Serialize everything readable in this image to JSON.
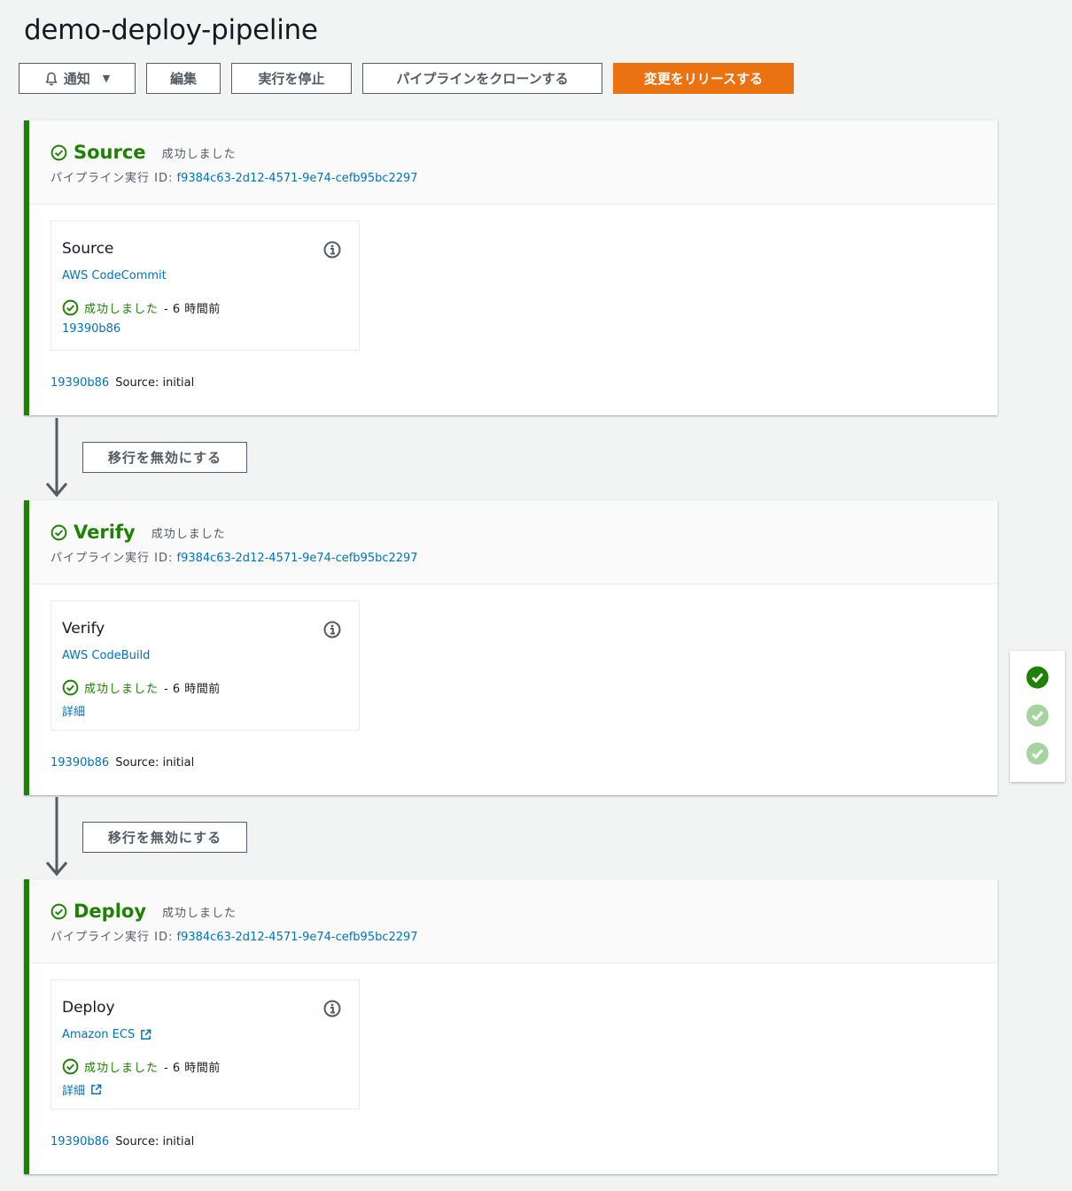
{
  "page": {
    "title": "demo-deploy-pipeline"
  },
  "toolbar": {
    "notify_label": "通知",
    "edit_label": "編集",
    "stop_label": "実行を停止",
    "clone_label": "パイプラインをクローンする",
    "release_label": "変更をリリースする"
  },
  "colors": {
    "success": "#1d8102",
    "link": "#0073bb",
    "primary": "#ec7211"
  },
  "stages": [
    {
      "name": "Source",
      "status": "成功しました",
      "exec_label": "パイプライン実行 ID:",
      "exec_id": "f9384c63-2d12-4571-9e74-cefb95bc2297",
      "action": {
        "name": "Source",
        "provider": "AWS CodeCommit",
        "status": "成功しました",
        "ago": "- 6 時間前",
        "link": "19390b86"
      },
      "commit": {
        "id": "19390b86",
        "message": "Source: initial"
      }
    },
    {
      "name": "Verify",
      "status": "成功しました",
      "exec_label": "パイプライン実行 ID:",
      "exec_id": "f9384c63-2d12-4571-9e74-cefb95bc2297",
      "action": {
        "name": "Verify",
        "provider": "AWS CodeBuild",
        "status": "成功しました",
        "ago": "- 6 時間前",
        "link": "詳細"
      },
      "commit": {
        "id": "19390b86",
        "message": "Source: initial"
      }
    },
    {
      "name": "Deploy",
      "status": "成功しました",
      "exec_label": "パイプライン実行 ID:",
      "exec_id": "f9384c63-2d12-4571-9e74-cefb95bc2297",
      "action": {
        "name": "Deploy",
        "provider": "Amazon ECS",
        "status": "成功しました",
        "ago": "- 6 時間前",
        "link": "詳細"
      },
      "commit": {
        "id": "19390b86",
        "message": "Source: initial"
      }
    }
  ],
  "transitions": [
    {
      "label": "移行を無効にする"
    },
    {
      "label": "移行を無効にする"
    }
  ],
  "icons": {
    "bell": "bell-icon",
    "caret": "caret-down-icon",
    "success": "check-circle-icon",
    "info": "info-icon",
    "external": "external-link-icon"
  }
}
